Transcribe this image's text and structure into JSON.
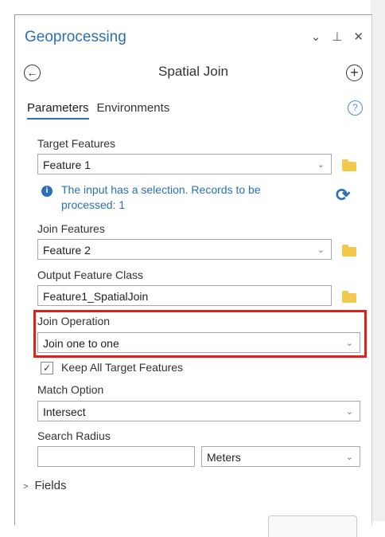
{
  "pane": {
    "title": "Geoprocessing",
    "controls": [
      "⌄",
      "⊥",
      "✕"
    ]
  },
  "tool": {
    "title": "Spatial Join"
  },
  "tabs": {
    "parameters": "Parameters",
    "environments": "Environments"
  },
  "target": {
    "label": "Target Features",
    "value": "Feature 1"
  },
  "info": {
    "message": "The input has a selection. Records to be processed: 1"
  },
  "join": {
    "label": "Join Features",
    "value": "Feature 2"
  },
  "output": {
    "label": "Output Feature Class",
    "value": "Feature1_SpatialJoin"
  },
  "operation": {
    "label": "Join Operation",
    "value": "Join one to one"
  },
  "keep": {
    "label": "Keep All Target Features",
    "checked": true
  },
  "match": {
    "label": "Match Option",
    "value": "Intersect"
  },
  "radius": {
    "label": "Search Radius",
    "value": "",
    "unit": "Meters"
  },
  "fields": {
    "label": "Fields"
  },
  "colors": {
    "accent": "#2a70b8",
    "highlight": "#e0201b",
    "folder": "#f2c94c"
  }
}
